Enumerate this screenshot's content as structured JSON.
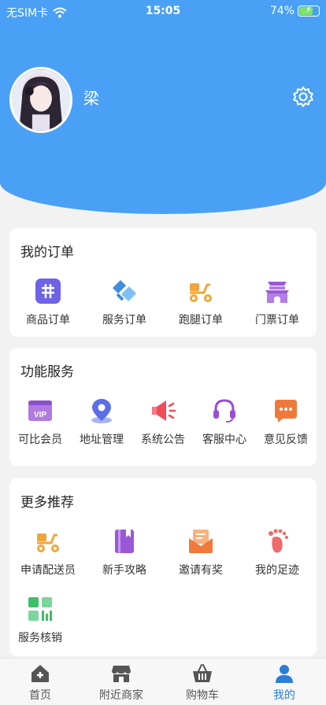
{
  "status_bar": {
    "carrier": "无SIM卡",
    "time": "15:05",
    "battery": "74%",
    "battery_level": 0.74
  },
  "profile": {
    "name": "梁"
  },
  "orders": {
    "title": "我的订单",
    "items": [
      {
        "label": "商品订单",
        "icon": "goods-order-icon",
        "color": "#6d62e8"
      },
      {
        "label": "服务订单",
        "icon": "service-order-icon",
        "color": "#4a9be8"
      },
      {
        "label": "跑腿订单",
        "icon": "errand-scooter-icon",
        "color": "#f0a63a"
      },
      {
        "label": "门票订单",
        "icon": "ticket-gate-icon",
        "color": "#9a58d6"
      }
    ]
  },
  "services": {
    "title": "功能服务",
    "items": [
      {
        "label": "可比会员",
        "icon": "vip-icon",
        "color": "#9b5ad6"
      },
      {
        "label": "地址管理",
        "icon": "location-pin-icon",
        "color": "#5b6ee8"
      },
      {
        "label": "系统公告",
        "icon": "megaphone-icon",
        "color": "#ef4d5b"
      },
      {
        "label": "客服中心",
        "icon": "headset-icon",
        "color": "#9a4fd4"
      },
      {
        "label": "意见反馈",
        "icon": "feedback-chat-icon",
        "color": "#f07a3c"
      }
    ]
  },
  "recommend": {
    "title": "更多推荐",
    "items": [
      {
        "label": "申请配送员",
        "icon": "delivery-scooter-icon",
        "color": "#f0a63a"
      },
      {
        "label": "新手攻略",
        "icon": "guide-book-icon",
        "color": "#9a58d6"
      },
      {
        "label": "邀请有奖",
        "icon": "invite-mail-icon",
        "color": "#f07a3c"
      },
      {
        "label": "我的足迹",
        "icon": "footprint-icon",
        "color": "#ef6a6a"
      },
      {
        "label": "服务核销",
        "icon": "verify-grid-icon",
        "color": "#3fbf6a"
      }
    ]
  },
  "tabbar": {
    "items": [
      {
        "label": "首页",
        "icon": "home-icon"
      },
      {
        "label": "附近商家",
        "icon": "store-icon"
      },
      {
        "label": "购物车",
        "icon": "basket-icon"
      },
      {
        "label": "我的",
        "icon": "person-icon",
        "active": true
      }
    ]
  }
}
